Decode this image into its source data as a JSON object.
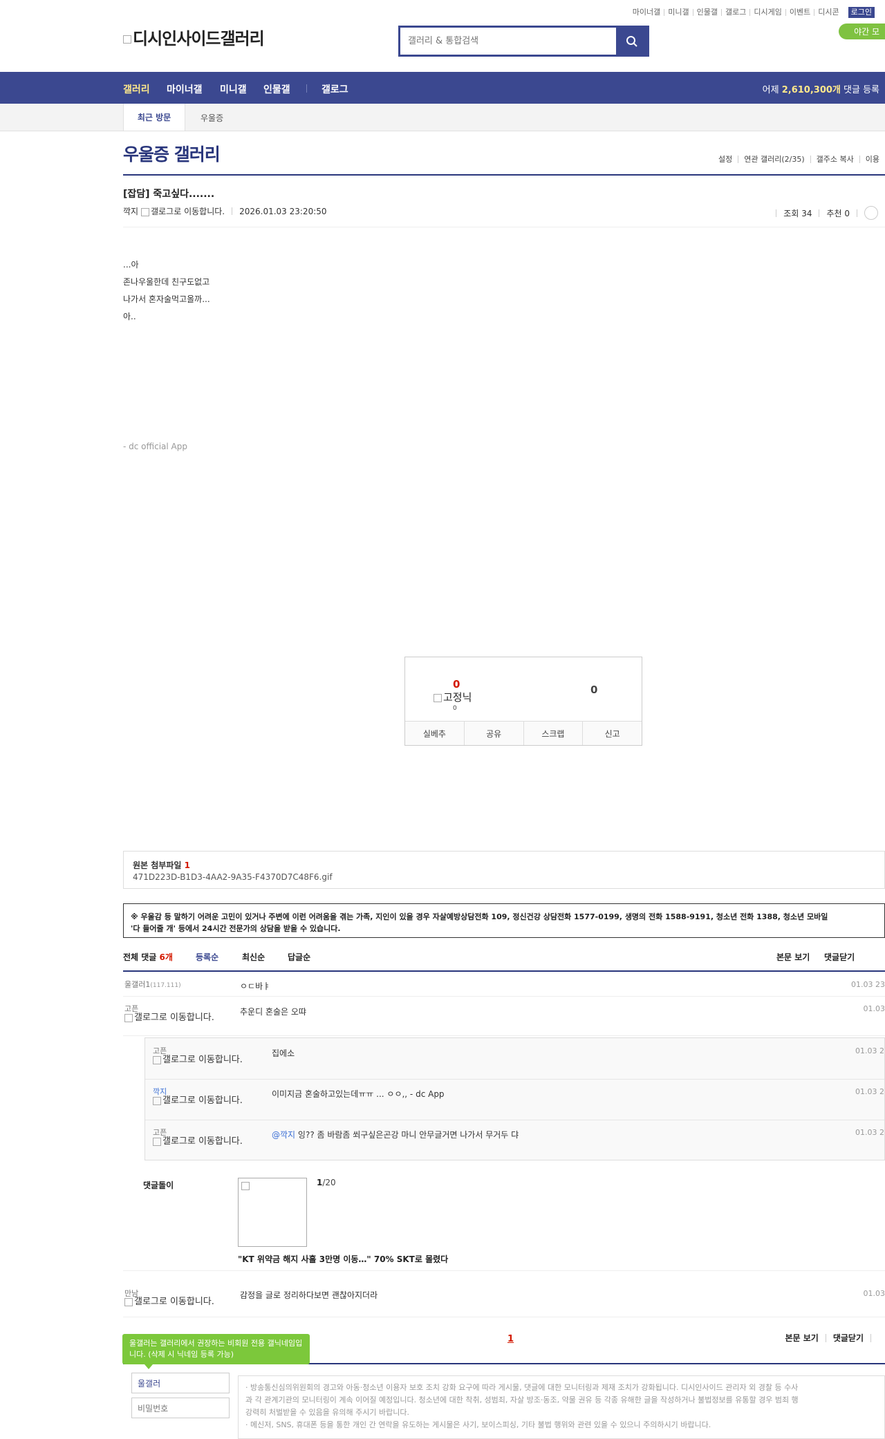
{
  "top_links": [
    "마이너갤",
    "미니갤",
    "인물갤",
    "갤로그",
    "디시게임",
    "이벤트",
    "디시콘"
  ],
  "login_label": "로그인",
  "logo_alt": "디시인사이드갤러리",
  "search": {
    "placeholder": "갤러리 & 통합검색"
  },
  "night_mode": "야간 모",
  "nav": {
    "items": [
      "갤러리",
      "마이너갤",
      "미니갤",
      "인물갤",
      "갤로그"
    ],
    "stats_prefix": "어제",
    "stats_count": "2,610,300개",
    "stats_suffix": "댓글 등록"
  },
  "recent": {
    "tab": "최근 방문",
    "item": "우울증"
  },
  "gallery": {
    "title": "우울증 갤러리",
    "menu": [
      "설정",
      "연관 갤러리(2/35)",
      "갤주소 복사",
      "이용"
    ]
  },
  "post": {
    "title": "[잡담] 죽고싶다.......",
    "author": "깍지",
    "author_icon_alt": "갤로그로 이동합니다.",
    "date": "2026.01.03 23:20:50",
    "views": "조회 34",
    "recommend": "추천 0",
    "body": [
      "...아",
      "존나우울한데 친구도없고",
      "나가서 혼자술먹고올까...",
      "아.."
    ],
    "signature": "- dc official App"
  },
  "recommend_box": {
    "up_count": "0",
    "fix_label": "고정닉",
    "fix_count": "0",
    "down_count": "0",
    "buttons": [
      "실베추",
      "공유",
      "스크랩",
      "신고"
    ]
  },
  "attachment": {
    "title": "원본 첨부파일",
    "count": "1",
    "file": "471D223D-B1D3-4AA2-9A35-F4370D7C48F6.gif"
  },
  "notice": {
    "line1": "※ 우울감 등 말하기 어려운 고민이 있거나 주변에 이런 어려움을 겪는 가족, 지인이 있을 경우 자살예방상담전화 109, 정신건강 상담전화 1577-0199, 생명의 전화 1588-9191, 청소년 전화 1388, 청소년 모바일",
    "line2": "'다 들어줄 개' 등에서 24시간 전문가의 상담을 받을 수 있습니다."
  },
  "comments_header": {
    "label": "전체 댓글",
    "count": "6개",
    "sorts": [
      "등록순",
      "최신순",
      "답글순"
    ],
    "actions": [
      "본문 보기",
      "댓글닫기"
    ]
  },
  "comments": [
    {
      "nick": "울갤러1",
      "ip": "(117.111)",
      "text": "ㅇㄷ바ㅑ",
      "date": "01.03 23"
    },
    {
      "nick": "고픈",
      "icon_alt": "갤로그로 이동합니다.",
      "text": "추운디 혼술은 오땨",
      "date": "01.03"
    }
  ],
  "replies": [
    {
      "nick": "고픈",
      "icon_alt": "갤로그로 이동합니다.",
      "text": "집에소",
      "date": "01.03 2"
    },
    {
      "nick": "깍지",
      "icon_alt": "갤로그로 이동합니다.",
      "text": "이미지금 혼술하고있는데ㅠㅠ ... ㅇㅇ,, - dc App",
      "date": "01.03 2"
    },
    {
      "nick": "고픈",
      "icon_alt": "갤로그로 이동합니다.",
      "mention": "@깍지",
      "text": " 잉?? 좀 바람좀 쐬구싶은곤강 마니 안무글거면 나가서 무거두 댜",
      "date": "01.03 2"
    }
  ],
  "ad": {
    "label": "댓글돌이",
    "page": "1",
    "page_total": "/20",
    "headline": "\"KT 위약금 해지 사흘 3만명 이동…\" 70% SKT로 몰렸다"
  },
  "last_comment": {
    "nick": "만남",
    "icon_alt": "갤로그로 이동합니다.",
    "text": "감정을 글로 정리하다보면 괜찮아지더라",
    "date": "01.03"
  },
  "pagination": {
    "current": "1"
  },
  "footer_actions": [
    "본문 보기",
    "댓글닫기"
  ],
  "tooltip": "울갤러는 갤러리에서 권장하는 비회원 전용 갤닉네임입니다. (삭제 시 닉네임 등록 가능)",
  "comment_form": {
    "nick_value": "울갤러",
    "password_placeholder": "비밀번호",
    "guide": [
      "· 방송통신심의위원회의 경고와 아동·청소년 이용자 보호 조치 강화 요구에 따라 게시물, 댓글에 대한 모니터링과 제재 조치가 강화됩니다. 디시인사이드 관리자 외 경찰 등 수사",
      "과 각 관계기관의 모니터링이 계속 이어질 예정입니다. 청소년에 대한 착취, 성범죄, 자살 방조·동조, 약물 권유 등 각종 유해한 글을 작성하거나 불법정보를 유통할 경우 범죄 행",
      "강력히 처벌받을 수 있음을 유의해 주시기 바랍니다.",
      "· 메신저, SNS, 휴대폰 등을 통한 개인 간 연락을 유도하는 게시물은 사기, 보이스피싱, 기타 불법 행위와 관련 있을 수 있으니 주의하시기 바랍니다."
    ]
  }
}
